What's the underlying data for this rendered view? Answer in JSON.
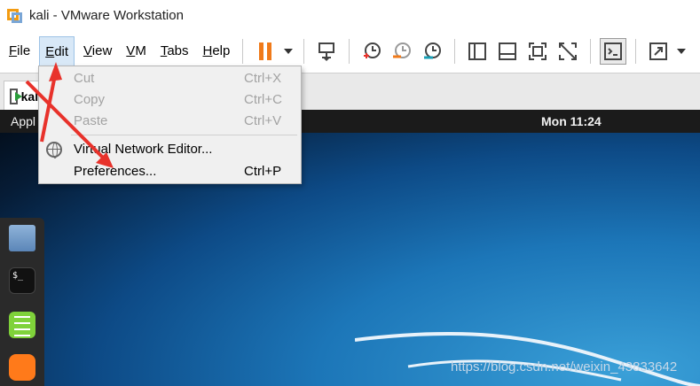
{
  "window": {
    "title": "kali - VMware Workstation"
  },
  "menubar": {
    "items": [
      {
        "label": "File",
        "ul": "F",
        "rest": "ile"
      },
      {
        "label": "Edit",
        "ul": "E",
        "rest": "dit"
      },
      {
        "label": "View",
        "ul": "V",
        "rest": "iew"
      },
      {
        "label": "VM",
        "ul": "V",
        "rest": "M"
      },
      {
        "label": "Tabs",
        "ul": "T",
        "rest": "abs"
      },
      {
        "label": "Help",
        "ul": "H",
        "rest": "elp"
      }
    ]
  },
  "tab": {
    "label": "kali"
  },
  "edit_menu": {
    "items": [
      {
        "label": "Cut",
        "shortcut": "Ctrl+X",
        "enabled": false
      },
      {
        "label": "Copy",
        "shortcut": "Ctrl+C",
        "enabled": false
      },
      {
        "label": "Paste",
        "shortcut": "Ctrl+V",
        "enabled": false
      },
      {
        "label": "Virtual Network Editor...",
        "shortcut": "",
        "enabled": true
      },
      {
        "label": "Preferences...",
        "shortcut": "Ctrl+P",
        "enabled": true
      }
    ]
  },
  "guest": {
    "apps_label": "Appl",
    "clock": "Mon 11:24",
    "terminal_glyph": "$_"
  },
  "watermark": "https://blog.csdn.net/weixin_43833642",
  "colors": {
    "accent": "#f07a1a",
    "arrow": "#e8322b",
    "menu_highlight": "#d8e8f7"
  }
}
